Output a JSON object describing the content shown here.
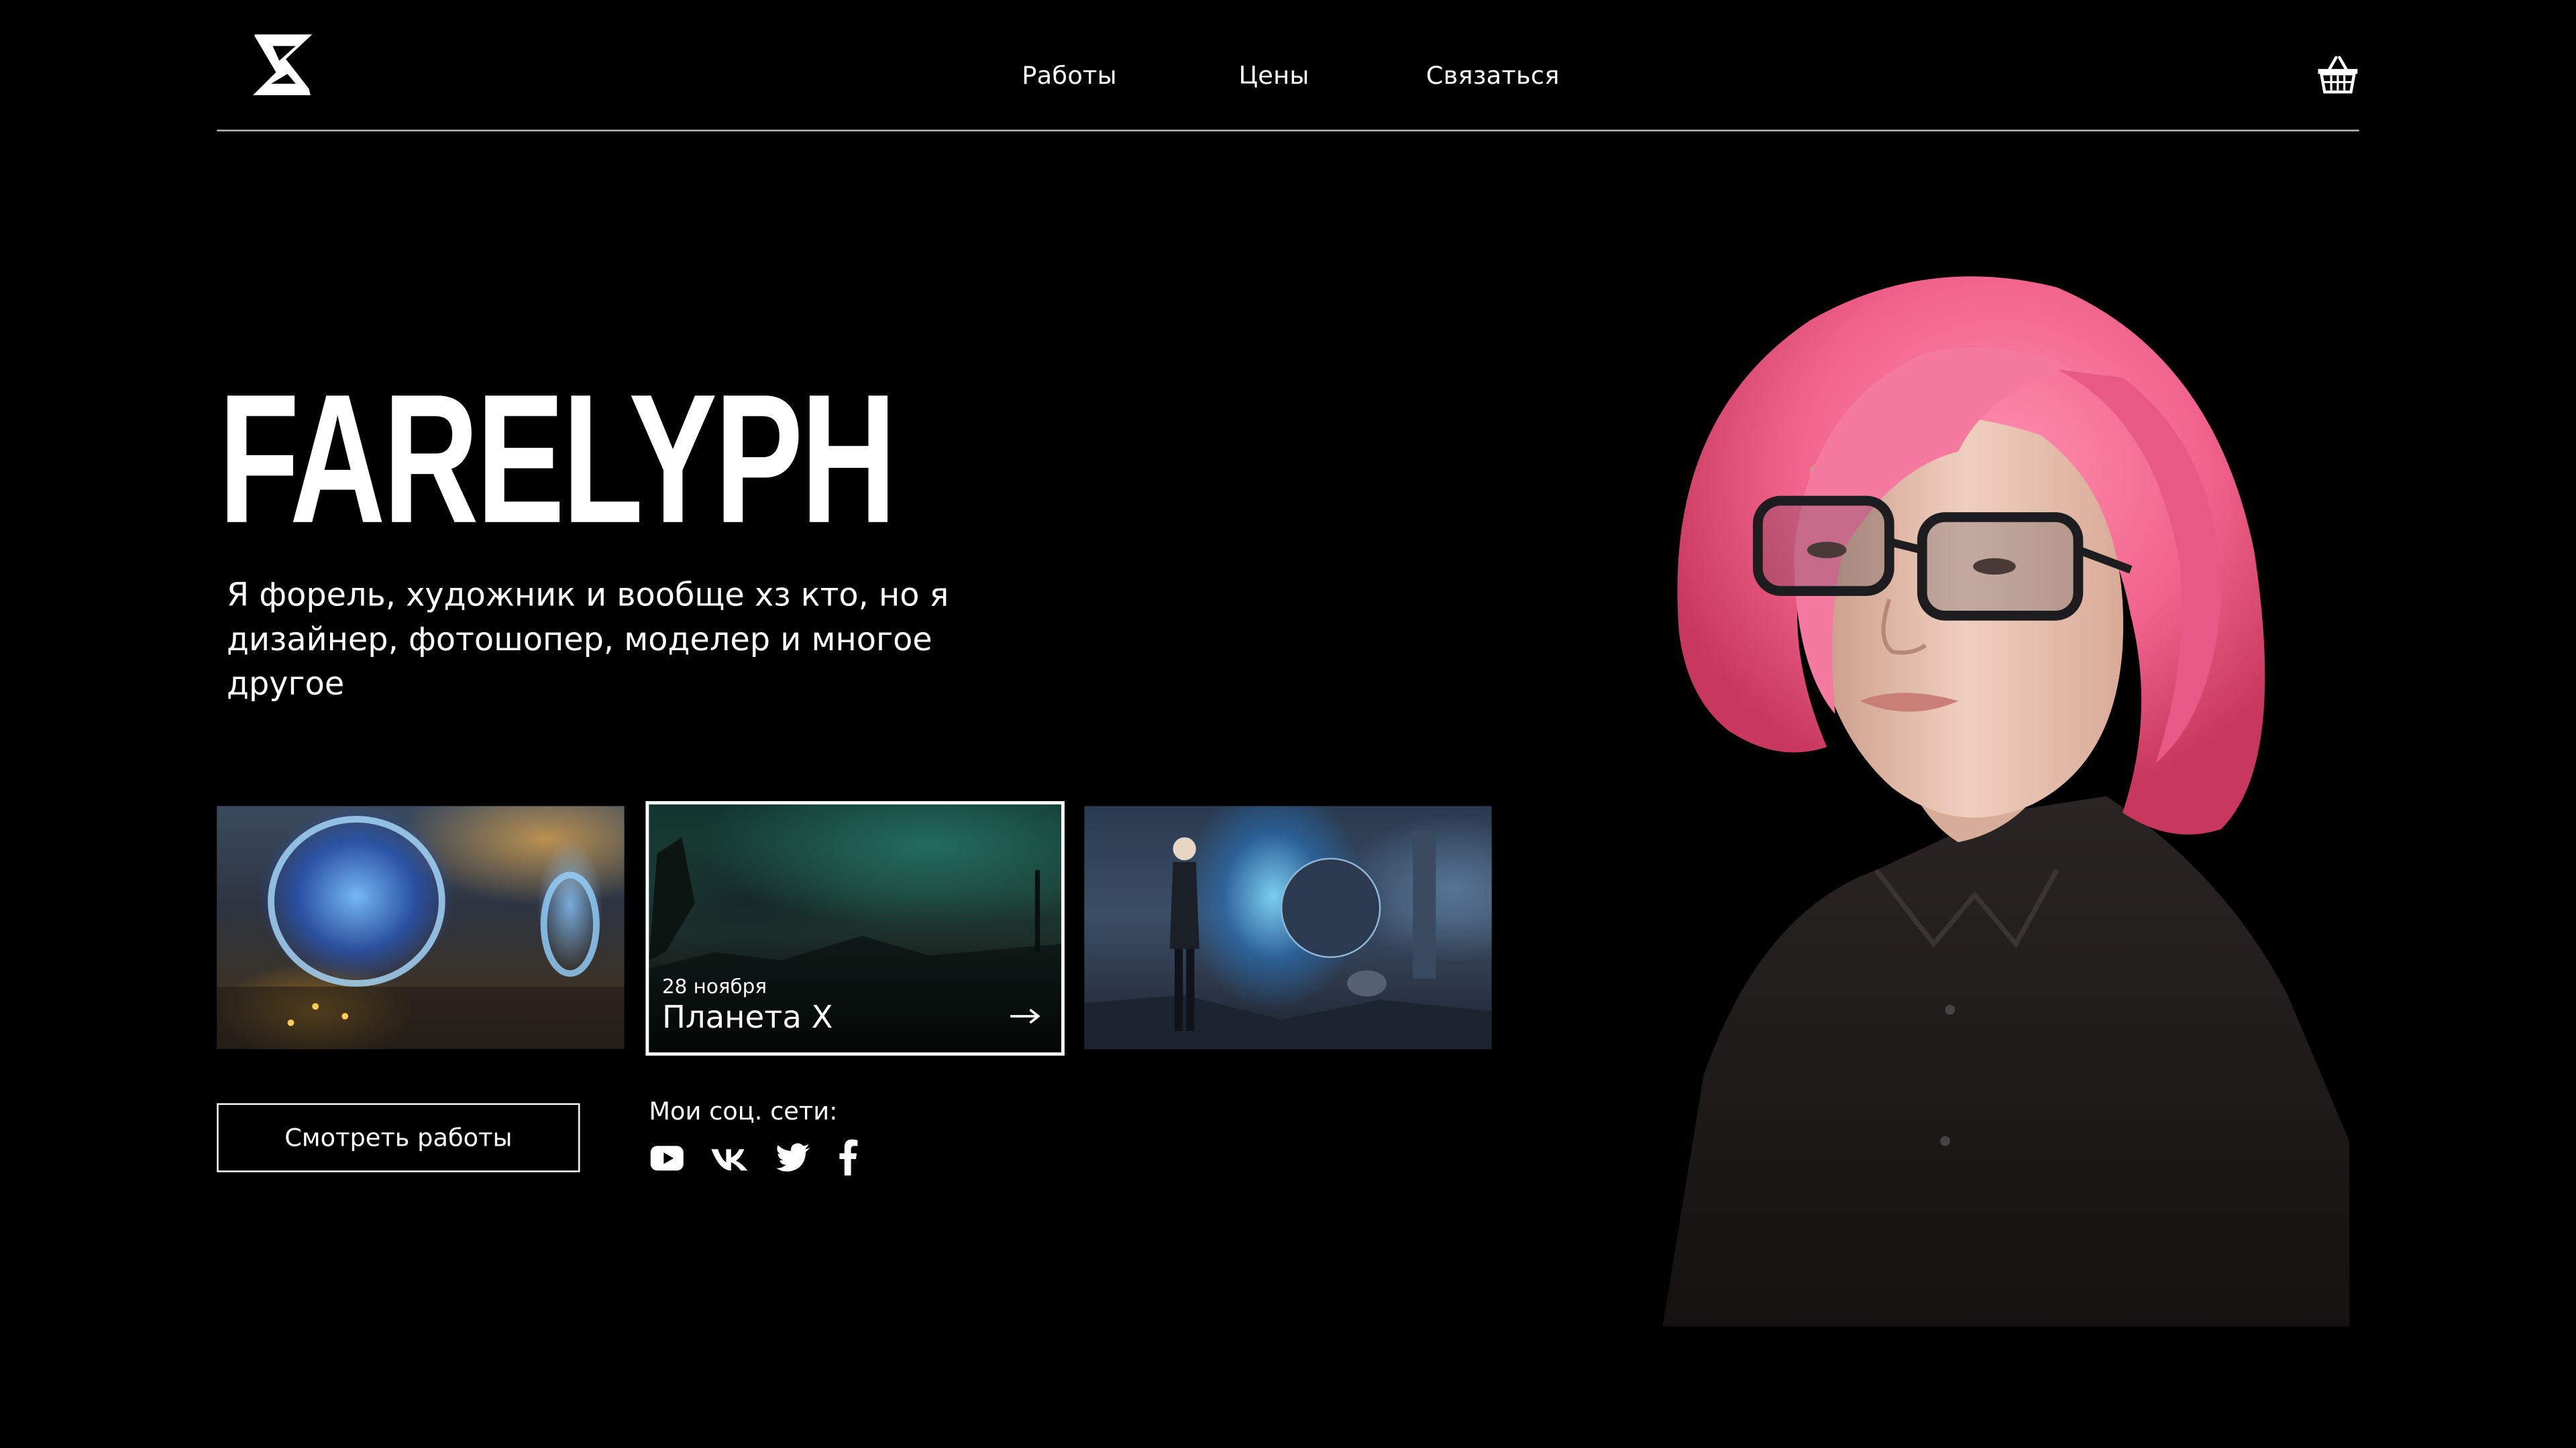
{
  "header": {
    "nav": [
      "Работы",
      "Цены",
      "Связаться"
    ]
  },
  "hero": {
    "title": "FARELYPH",
    "description": "Я форель, художник и вообще хз кто, но я дизайнер, фотошопер, моделер и многое другое"
  },
  "cards": [
    {},
    {
      "date": "28 ноября",
      "title": "Планета X"
    },
    {}
  ],
  "cta": {
    "label": "Смотреть работы"
  },
  "social": {
    "label": "Мои соц. сети:",
    "icons": [
      "youtube-icon",
      "vk-icon",
      "twitter-icon",
      "facebook-icon"
    ]
  },
  "colors": {
    "background": "#000000",
    "text": "#ffffff",
    "hair": "#f06d93"
  }
}
